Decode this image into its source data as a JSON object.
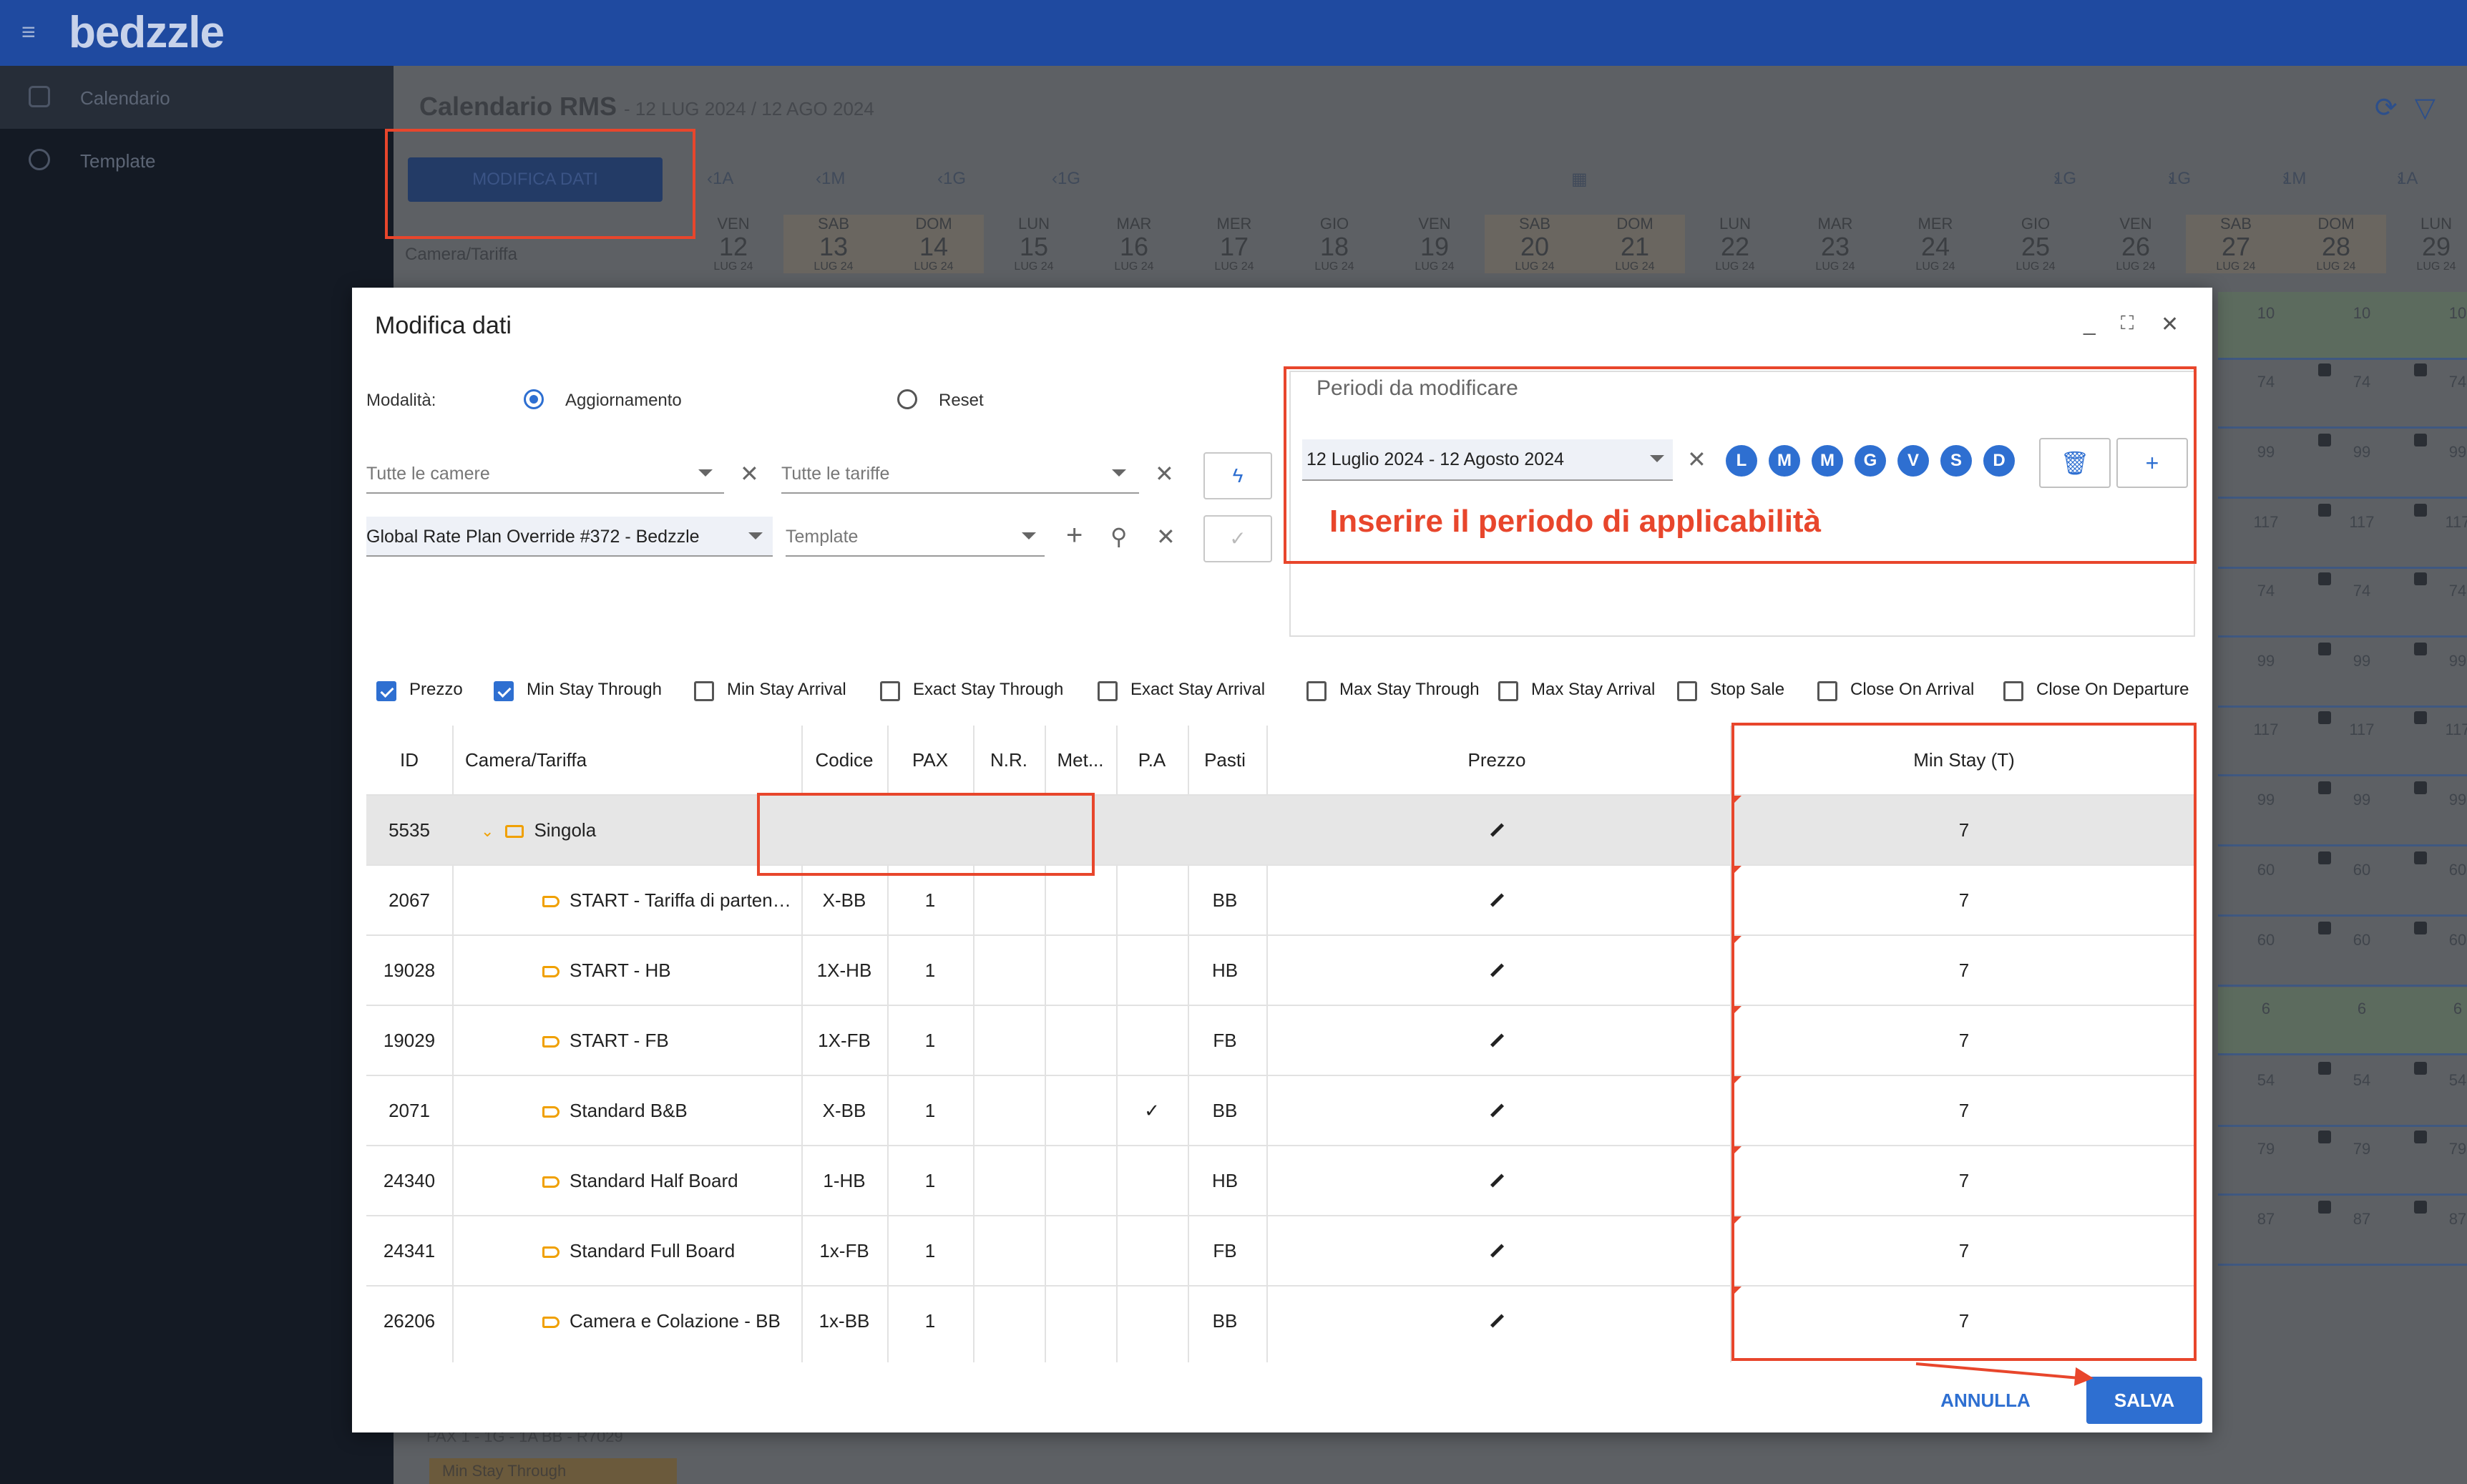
{
  "app": {
    "logo": "bedzzle"
  },
  "sidebar": {
    "items": [
      {
        "label": "Calendario"
      },
      {
        "label": "Template"
      }
    ]
  },
  "calendar": {
    "title": "Calendario RMS",
    "subtitle": "- 12 LUG 2024 / 12 AGO 2024",
    "modify_button": "MODIFICA DATI",
    "row_header": "Camera/Tariffa",
    "nav_left": [
      "1A",
      "1M",
      "1G",
      "1G"
    ],
    "nav_right": [
      "1G",
      "1G",
      "1M",
      "1A"
    ],
    "days": [
      {
        "dow": "VEN",
        "day": "12",
        "mon": "LUG 24"
      },
      {
        "dow": "SAB",
        "day": "13",
        "mon": "LUG 24"
      },
      {
        "dow": "DOM",
        "day": "14",
        "mon": "LUG 24"
      },
      {
        "dow": "LUN",
        "day": "15",
        "mon": "LUG 24"
      },
      {
        "dow": "MAR",
        "day": "16",
        "mon": "LUG 24"
      },
      {
        "dow": "MER",
        "day": "17",
        "mon": "LUG 24"
      },
      {
        "dow": "GIO",
        "day": "18",
        "mon": "LUG 24"
      },
      {
        "dow": "VEN",
        "day": "19",
        "mon": "LUG 24"
      },
      {
        "dow": "SAB",
        "day": "20",
        "mon": "LUG 24"
      },
      {
        "dow": "DOM",
        "day": "21",
        "mon": "LUG 24"
      },
      {
        "dow": "LUN",
        "day": "22",
        "mon": "LUG 24"
      },
      {
        "dow": "MAR",
        "day": "23",
        "mon": "LUG 24"
      },
      {
        "dow": "MER",
        "day": "24",
        "mon": "LUG 24"
      },
      {
        "dow": "GIO",
        "day": "25",
        "mon": "LUG 24"
      },
      {
        "dow": "VEN",
        "day": "26",
        "mon": "LUG 24"
      },
      {
        "dow": "SAB",
        "day": "27",
        "mon": "LUG 24"
      },
      {
        "dow": "DOM",
        "day": "28",
        "mon": "LUG 24"
      },
      {
        "dow": "LUN",
        "day": "29",
        "mon": "LUG 24"
      }
    ],
    "right_values": [
      [
        "10",
        "10",
        "10"
      ],
      [
        "74",
        "74",
        "74"
      ],
      [
        "99",
        "99",
        "99"
      ],
      [
        "117",
        "117",
        "117"
      ],
      [
        "74",
        "74",
        "74"
      ],
      [
        "99",
        "99",
        "99"
      ],
      [
        "117",
        "117",
        "117"
      ],
      [
        "99",
        "99",
        "99"
      ],
      [
        "60",
        "60",
        "60"
      ],
      [
        "60",
        "60",
        "60"
      ],
      [
        "6",
        "6",
        "6"
      ],
      [
        "54",
        "54",
        "54"
      ],
      [
        "79",
        "79",
        "79"
      ],
      [
        "87",
        "87",
        "87"
      ]
    ],
    "below_row1": "PAX 1 - 1G - 1A BB - R7029",
    "below_row2": "Min Stay Through"
  },
  "dialog": {
    "title": "Modifica dati",
    "mode_label": "Modalità:",
    "mode_update": "Aggiornamento",
    "mode_reset": "Reset",
    "rooms_placeholder": "Tutte le camere",
    "rates_placeholder": "Tutte le tariffe",
    "rate_plan_value": "Global Rate Plan Override #372 - Bedzzle",
    "template_placeholder": "Template",
    "periods": {
      "legend": "Periodi da modificare",
      "range": "12 Luglio 2024 - 12 Agosto 2024",
      "weekdays": [
        "L",
        "M",
        "M",
        "G",
        "V",
        "S",
        "D"
      ]
    },
    "annotation": "Inserire il periodo di applicabilità",
    "checks": [
      {
        "label": "Prezzo",
        "checked": true
      },
      {
        "label": "Min Stay Through",
        "checked": true
      },
      {
        "label": "Min Stay Arrival",
        "checked": false
      },
      {
        "label": "Exact Stay Through",
        "checked": false
      },
      {
        "label": "Exact Stay Arrival",
        "checked": false
      },
      {
        "label": "Max Stay Through",
        "checked": false
      },
      {
        "label": "Max Stay Arrival",
        "checked": false
      },
      {
        "label": "Stop Sale",
        "checked": false
      },
      {
        "label": "Close On Arrival",
        "checked": false
      },
      {
        "label": "Close On Departure",
        "checked": false
      }
    ],
    "table": {
      "headers": [
        "ID",
        "Camera/Tariffa",
        "Codice",
        "PAX",
        "N.R.",
        "Met...",
        "P.A",
        "Pasti",
        "Prezzo",
        "Min Stay (T)"
      ],
      "rows": [
        {
          "id": "5535",
          "name": "Singola",
          "code": "",
          "pax": "",
          "nr": "",
          "met": "",
          "pa": "",
          "pasti": "",
          "minstay": "7",
          "group": true
        },
        {
          "id": "2067",
          "name": "START - Tariffa di parten…",
          "code": "X-BB",
          "pax": "1",
          "nr": "",
          "met": "",
          "pa": "",
          "pasti": "BB",
          "minstay": "7",
          "group": false
        },
        {
          "id": "19028",
          "name": "START - HB",
          "code": "1X-HB",
          "pax": "1",
          "nr": "",
          "met": "",
          "pa": "",
          "pasti": "HB",
          "minstay": "7",
          "group": false
        },
        {
          "id": "19029",
          "name": "START - FB",
          "code": "1X-FB",
          "pax": "1",
          "nr": "",
          "met": "",
          "pa": "",
          "pasti": "FB",
          "minstay": "7",
          "group": false
        },
        {
          "id": "2071",
          "name": "Standard B&B",
          "code": "X-BB",
          "pax": "1",
          "nr": "",
          "met": "",
          "pa": "✓",
          "pasti": "BB",
          "minstay": "7",
          "group": false
        },
        {
          "id": "24340",
          "name": "Standard Half Board",
          "code": "1-HB",
          "pax": "1",
          "nr": "",
          "met": "",
          "pa": "",
          "pasti": "HB",
          "minstay": "7",
          "group": false
        },
        {
          "id": "24341",
          "name": "Standard Full Board",
          "code": "1x-FB",
          "pax": "1",
          "nr": "",
          "met": "",
          "pa": "",
          "pasti": "FB",
          "minstay": "7",
          "group": false
        },
        {
          "id": "26206",
          "name": "Camera e Colazione - BB",
          "code": "1x-BB",
          "pax": "1",
          "nr": "",
          "met": "",
          "pa": "",
          "pasti": "BB",
          "minstay": "7",
          "group": false
        }
      ]
    },
    "cancel": "ANNULLA",
    "save": "SALVA"
  },
  "colors": {
    "accent": "#2e6fd1",
    "annotation": "#e8462c",
    "rate_icon": "#f0a000"
  }
}
